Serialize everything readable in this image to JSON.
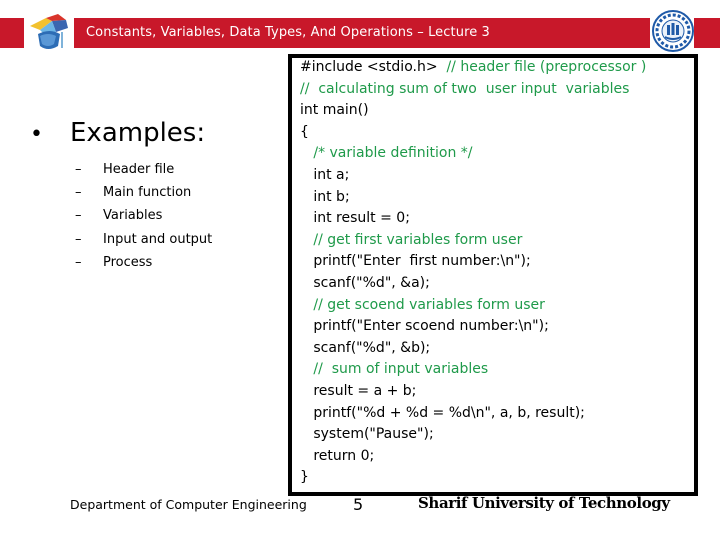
{
  "header": {
    "title": "Constants, Variables, Data Types, And Operations – Lecture 3",
    "accent_color": "#c8182a",
    "left_logo_icon": "puzzle-graduation-cap-icon",
    "right_logo_icon": "sharif-university-seal-icon"
  },
  "main": {
    "heading_bullet": "•",
    "heading": "Examples:",
    "items": [
      {
        "dash": "–",
        "label": "Header file"
      },
      {
        "dash": "–",
        "label": "Main function"
      },
      {
        "dash": "–",
        "label": "Variables"
      },
      {
        "dash": "–",
        "label": "Input and output"
      },
      {
        "dash": "–",
        "label": "Process"
      }
    ]
  },
  "code": {
    "comment_color": "#1f9a4a",
    "lines": [
      {
        "code": "#include <stdio.h>  ",
        "comment": "// header file (preprocessor )"
      },
      {
        "code": "",
        "comment": "//  calculating sum of two  user input  variables"
      },
      {
        "code": "int main()",
        "comment": ""
      },
      {
        "code": "{",
        "comment": ""
      },
      {
        "code": "   ",
        "comment": "/* variable definition */"
      },
      {
        "code": "   int a;",
        "comment": ""
      },
      {
        "code": "   int b;",
        "comment": ""
      },
      {
        "code": "   int result = 0;",
        "comment": ""
      },
      {
        "code": "   ",
        "comment": "// get first variables form user"
      },
      {
        "code": "   printf(\"Enter  first number:\\n\");",
        "comment": ""
      },
      {
        "code": "   scanf(\"%d\", &a);",
        "comment": ""
      },
      {
        "code": "   ",
        "comment": "// get scoend variables form user"
      },
      {
        "code": "   printf(\"Enter scoend number:\\n\");",
        "comment": ""
      },
      {
        "code": "   scanf(\"%d\", &b);",
        "comment": ""
      },
      {
        "code": "   ",
        "comment": "//  sum of input variables"
      },
      {
        "code": "   result = a + b;",
        "comment": ""
      },
      {
        "code": "   printf(\"%d + %d = %d\\n\", a, b, result);",
        "comment": ""
      },
      {
        "code": "   system(\"Pause\");",
        "comment": ""
      },
      {
        "code": "   return 0;",
        "comment": ""
      },
      {
        "code": "}",
        "comment": ""
      }
    ]
  },
  "footer": {
    "department": "Department of Computer Engineering",
    "page_number": "5",
    "university": "Sharif University of Technology"
  }
}
